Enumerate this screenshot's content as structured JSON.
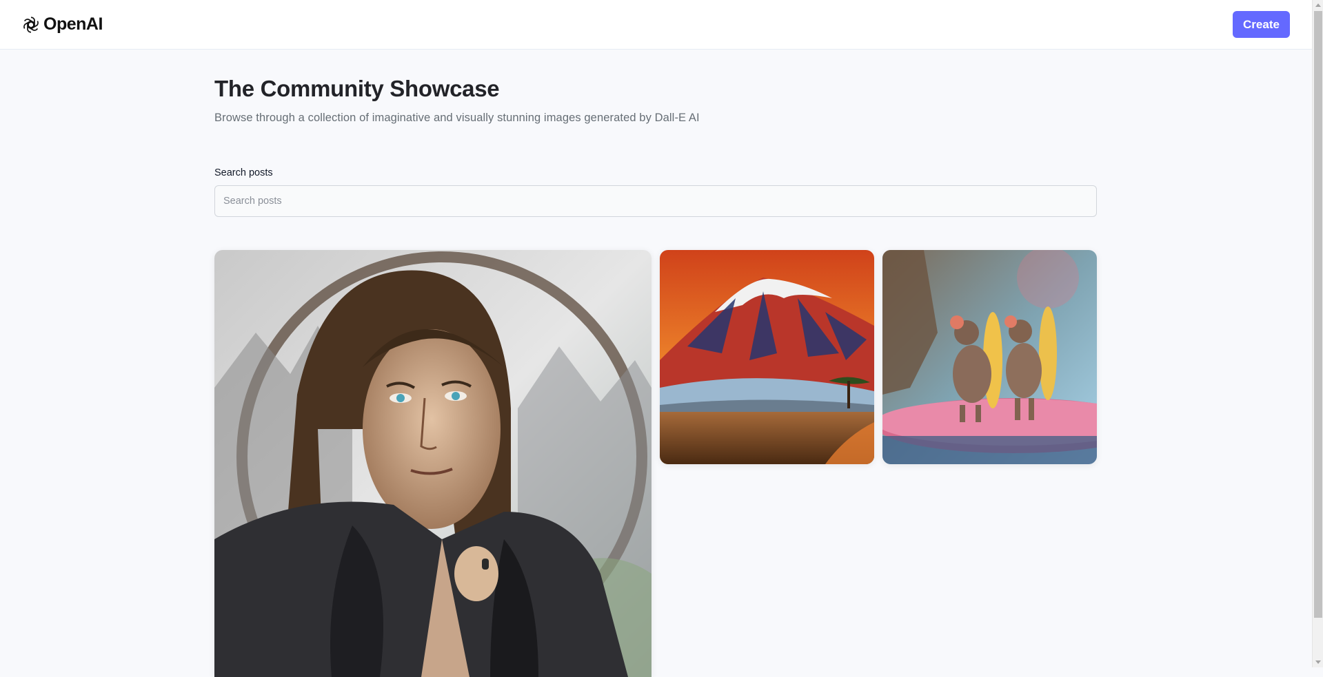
{
  "header": {
    "logo_text": "OpenAI",
    "logo_icon": "openai-logo-icon",
    "create_label": "Create",
    "accent_color": "#6469ff"
  },
  "main": {
    "title": "The Community Showcase",
    "subtitle": "Browse through a collection of imaginative and visually stunning images generated by Dall-E AI",
    "search": {
      "label": "Search posts",
      "placeholder": "Search posts",
      "value": ""
    }
  },
  "gallery": {
    "posts": [
      {
        "image": "portrait-long-haired-man-painting"
      },
      {
        "image": "red-mountain-landscape-painting"
      },
      {
        "image": "mice-with-surfboards-photo"
      }
    ]
  }
}
